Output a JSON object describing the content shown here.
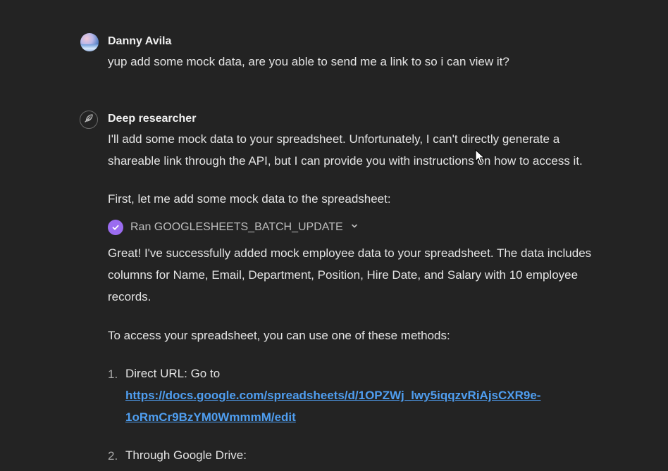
{
  "user_message": {
    "author": "Danny Avila",
    "text": "yup add some mock data, are you able to send me a link to so i can view it?"
  },
  "assistant_message": {
    "author": "Deep researcher",
    "intro_line1": "I'll add some mock data to your spreadsheet. Unfortunately, I can't directly generate a",
    "intro_line2": "shareable link through the API, but I can provide you with instructions on how to access it.",
    "first_line": "First, let me add some mock data to the spreadsheet:",
    "tool_call": {
      "label": "Ran GOOGLESHEETS_BATCH_UPDATE",
      "status_color": "#9b6cf0"
    },
    "result_line1": "Great! I've successfully added mock employee data to your spreadsheet. The data includes",
    "result_line2": "columns for Name, Email, Department, Position, Hire Date, and Salary with 10 employee",
    "result_line3": "records.",
    "access_line": "To access your spreadsheet, you can use one of these methods:",
    "list": [
      {
        "number": "1.",
        "label": "Direct URL: Go to",
        "link_line1": "https://docs.google.com/spreadsheets/d/1OPZWj_lwy5iqqzvRiAjsCXR9e-",
        "link_line2": "1oRmCr9BzYM0WmmmM/edit"
      },
      {
        "number": "2.",
        "label": "Through Google Drive:"
      }
    ]
  },
  "colors": {
    "background": "#232323",
    "link": "#4f9ef0",
    "accent": "#9b6cf0"
  }
}
